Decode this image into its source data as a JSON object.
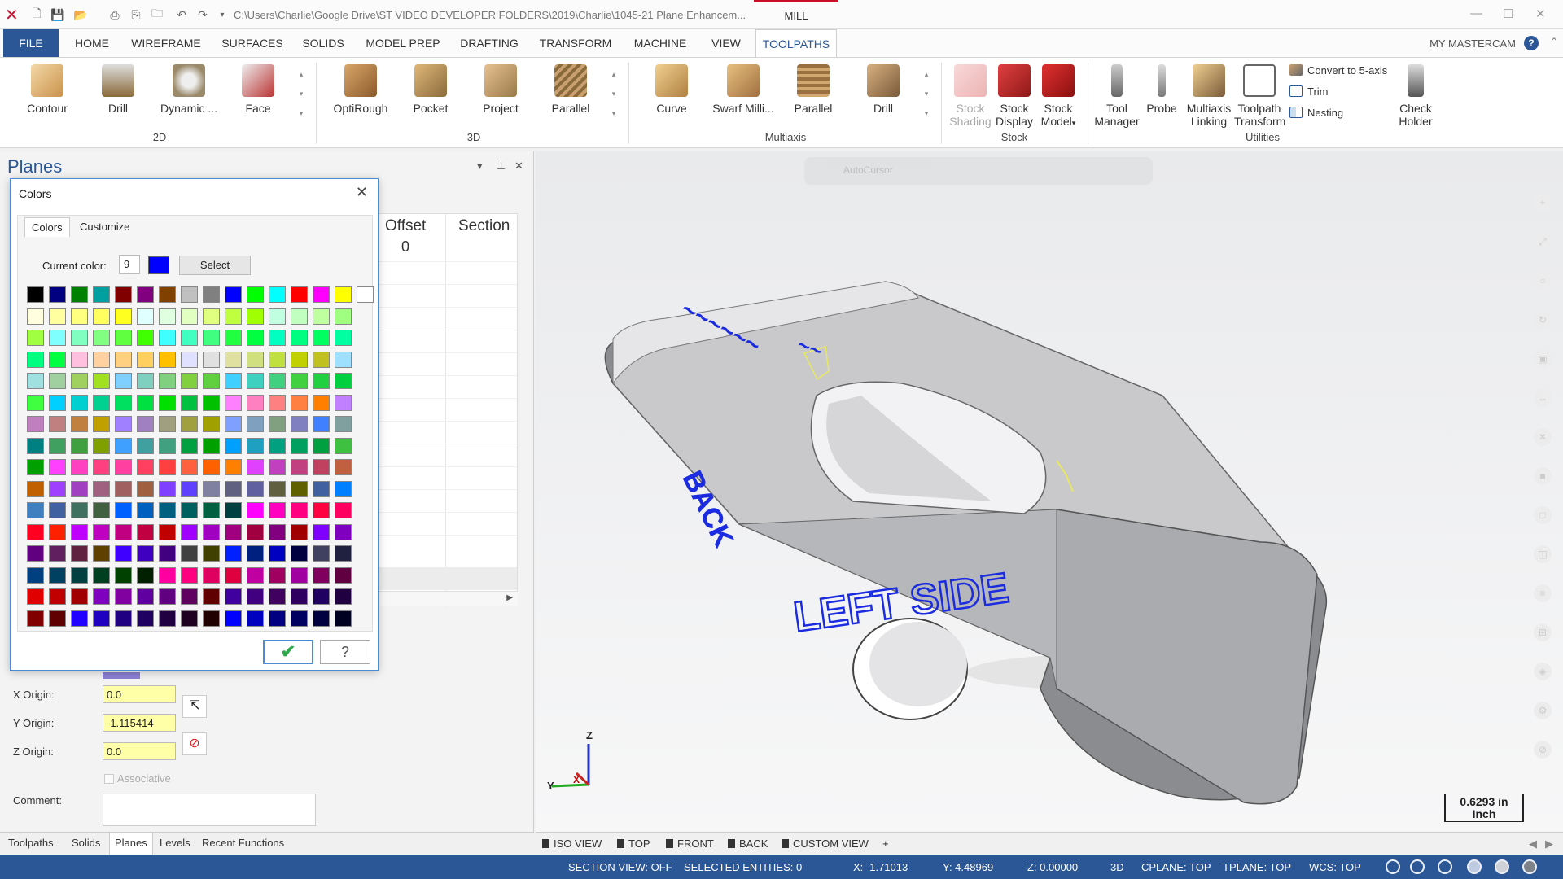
{
  "titlebar": {
    "path": "C:\\Users\\Charlie\\Google Drive\\ST VIDEO DEVELOPER FOLDERS\\2019\\Charlie\\1045-21 Plane Enhancem...",
    "context_tab": "MILL"
  },
  "tabs": [
    "FILE",
    "HOME",
    "WIREFRAME",
    "SURFACES",
    "SOLIDS",
    "MODEL PREP",
    "DRAFTING",
    "TRANSFORM",
    "MACHINE",
    "VIEW",
    "TOOLPATHS"
  ],
  "active_tab": "TOOLPATHS",
  "my_mastercam": "MY MASTERCAM",
  "ribbon": {
    "group_2d": {
      "label": "2D",
      "buttons": [
        "Contour",
        "Drill",
        "Dynamic ...",
        "Face"
      ]
    },
    "group_3d": {
      "label": "3D",
      "buttons": [
        "OptiRough",
        "Pocket",
        "Project",
        "Parallel"
      ]
    },
    "group_multiaxis": {
      "label": "Multiaxis",
      "buttons": [
        "Curve",
        "Swarf Milli...",
        "Parallel",
        "Drill"
      ]
    },
    "group_stock": {
      "label": "Stock",
      "buttons": [
        [
          "Stock",
          "Shading"
        ],
        [
          "Stock",
          "Display"
        ],
        [
          "Stock",
          "Model"
        ]
      ]
    },
    "group_utilities": {
      "label": "Utilities",
      "buttons": [
        [
          "Tool",
          "Manager"
        ],
        [
          "Probe",
          ""
        ],
        [
          "Multiaxis",
          "Linking"
        ],
        [
          "Toolpath",
          "Transform"
        ],
        [
          "Check",
          "Holder"
        ]
      ],
      "small_buttons": [
        "Convert to 5-axis",
        "Trim",
        "Nesting"
      ]
    }
  },
  "planes": {
    "title": "Planes",
    "grid_headers": [
      "Offset",
      "Section"
    ],
    "offset_value": "0",
    "x_origin_label": "X Origin:",
    "x_origin": "0.0",
    "y_origin_label": "Y Origin:",
    "y_origin": "-1.115414",
    "z_origin_label": "Z Origin:",
    "z_origin": "0.0",
    "associative": "Associative",
    "comment_label": "Comment:"
  },
  "colors_dialog": {
    "title": "Colors",
    "tabs": [
      "Colors",
      "Customize"
    ],
    "current_color_label": "Current color:",
    "current_color_number": "9",
    "current_color_hex": "#0000ff",
    "select_label": "Select",
    "palette": [
      [
        "#000000",
        "#000080",
        "#008000",
        "#00a0a0",
        "#800000",
        "#800080",
        "#804000",
        "#c0c0c0",
        "#808080",
        "#0000ff",
        "#00ff00",
        "#00ffff",
        "#ff0000",
        "#ff00ff",
        "#ffff00",
        "#ffffff"
      ],
      [
        "#ffffe0",
        "#ffffa0",
        "#ffff80",
        "#ffff60",
        "#ffff20",
        "#e0ffff",
        "#e0ffe0",
        "#e0ffc0",
        "#e0ff80",
        "#c0ff40",
        "#a0ff00",
        "#c0ffe0",
        "#c0ffc0",
        "#c0ffa0",
        "#a0ff80"
      ],
      [
        "#a0ff40",
        "#80ffff",
        "#80ffc0",
        "#80ff80",
        "#60ff40",
        "#40ff00",
        "#40ffff",
        "#40ffc0",
        "#40ff80",
        "#20ff40",
        "#00ff40",
        "#00ffc0",
        "#00ff80",
        "#00ff60",
        "#00ffa0"
      ],
      [
        "#00ff80",
        "#00ff40",
        "#ffc0e0",
        "#ffd0a0",
        "#ffd080",
        "#ffd060",
        "#ffc000",
        "#e0e0ff",
        "#e0e0e0",
        "#e0e0a0",
        "#d0e080",
        "#c0e040",
        "#c0d000",
        "#c0c020",
        "#a0e0ff"
      ],
      [
        "#a0e0e0",
        "#a0d0a0",
        "#a0d060",
        "#a0e020",
        "#80d0ff",
        "#80d0c0",
        "#80d080",
        "#80d040",
        "#60d040",
        "#40d0ff",
        "#40d0c0",
        "#40d080",
        "#40d040",
        "#20d040",
        "#00d040"
      ],
      [
        "#40ff40",
        "#00d0ff",
        "#00d0d0",
        "#00d090",
        "#00e060",
        "#00e040",
        "#00e000",
        "#00c040",
        "#00c000",
        "#ff80ff",
        "#ff80c0",
        "#ff8080",
        "#ff8040",
        "#ff8000",
        "#c080ff"
      ],
      [
        "#c080c0",
        "#c08080",
        "#c08040",
        "#c0a000",
        "#a080ff",
        "#a080c0",
        "#a0a080",
        "#a0a040",
        "#a0a000",
        "#80a0ff",
        "#80a0c0",
        "#80a080",
        "#8080c0",
        "#4080ff",
        "#80a0a0"
      ],
      [
        "#008080",
        "#40a060",
        "#40a040",
        "#80a000",
        "#40a0ff",
        "#40a0a0",
        "#40a080",
        "#00a040",
        "#00a000",
        "#00a0ff",
        "#20a0c0",
        "#00a080",
        "#00a060",
        "#00a040",
        "#40c040"
      ],
      [
        "#00a000",
        "#ff40ff",
        "#ff40c0",
        "#ff4080",
        "#ff40a0",
        "#ff4060",
        "#ff4040",
        "#ff6040",
        "#ff6000",
        "#ff8000",
        "#e040ff",
        "#c040c0",
        "#c04080",
        "#c04060",
        "#c06040"
      ],
      [
        "#c06000",
        "#a040ff",
        "#a040c0",
        "#a06080",
        "#a06060",
        "#a06040",
        "#8040ff",
        "#6040ff",
        "#8080a0",
        "#606080",
        "#6060a0",
        "#606040",
        "#606000",
        "#4060a0",
        "#0080ff"
      ],
      [
        "#4080c0",
        "#4060a0",
        "#407060",
        "#406040",
        "#0060ff",
        "#0060c0",
        "#006080",
        "#006060",
        "#006040",
        "#004040",
        "#ff00ff",
        "#ff00c0",
        "#ff0080",
        "#ff0040",
        "#ff0060"
      ],
      [
        "#ff0020",
        "#ff2000",
        "#c000ff",
        "#c000c0",
        "#c00080",
        "#c00040",
        "#c00000",
        "#a000ff",
        "#a000c0",
        "#a00080",
        "#a00040",
        "#800080",
        "#a00000",
        "#8000ff",
        "#8000c0"
      ],
      [
        "#600080",
        "#602060",
        "#602040",
        "#604000",
        "#4000ff",
        "#4000c0",
        "#400080",
        "#404040",
        "#404000",
        "#0020ff",
        "#002080",
        "#0000c0",
        "#000040",
        "#404060",
        "#202040"
      ],
      [
        "#004080",
        "#004060",
        "#004040",
        "#004020",
        "#004000",
        "#002000",
        "#ff00a0",
        "#ff0080",
        "#e00060",
        "#e00040",
        "#c000a0",
        "#a00060",
        "#a000a0",
        "#800060",
        "#600040"
      ],
      [
        "#e00000",
        "#c00000",
        "#a00000",
        "#8000c0",
        "#8000a0",
        "#6000a0",
        "#600080",
        "#600060",
        "#600000",
        "#4000a0",
        "#400080",
        "#400060",
        "#300060",
        "#200060",
        "#200040"
      ],
      [
        "#800000",
        "#600000",
        "#2000ff",
        "#2000c0",
        "#200080",
        "#200060",
        "#200040",
        "#200020",
        "#200000",
        "#0000ff",
        "#0000c0",
        "#000080",
        "#000060",
        "#000040",
        "#000020"
      ]
    ]
  },
  "bottom_tabs": [
    "Toolpaths",
    "Solids",
    "Planes",
    "Levels",
    "Recent Functions"
  ],
  "active_bottom_tab": "Planes",
  "viewport": {
    "autocursor": "AutoCursor",
    "label_left_side": "LEFT SIDE",
    "label_back": "BACK",
    "scale_value": "0.6293 in",
    "scale_unit": "Inch",
    "axis_z": "Z",
    "axis_y": "Y",
    "axis_x": "X"
  },
  "view_tabs": [
    "ISO VIEW",
    "TOP",
    "FRONT",
    "BACK",
    "CUSTOM VIEW",
    "+"
  ],
  "status": {
    "section_view": "SECTION VIEW: OFF",
    "selected": "SELECTED ENTITIES: 0",
    "x": "X:   -1.71013",
    "y": "Y:   4.48969",
    "z": "Z:   0.00000",
    "mode": "3D",
    "cplane": "CPLANE: TOP",
    "tplane": "TPLANE: TOP",
    "wcs": "WCS: TOP"
  }
}
